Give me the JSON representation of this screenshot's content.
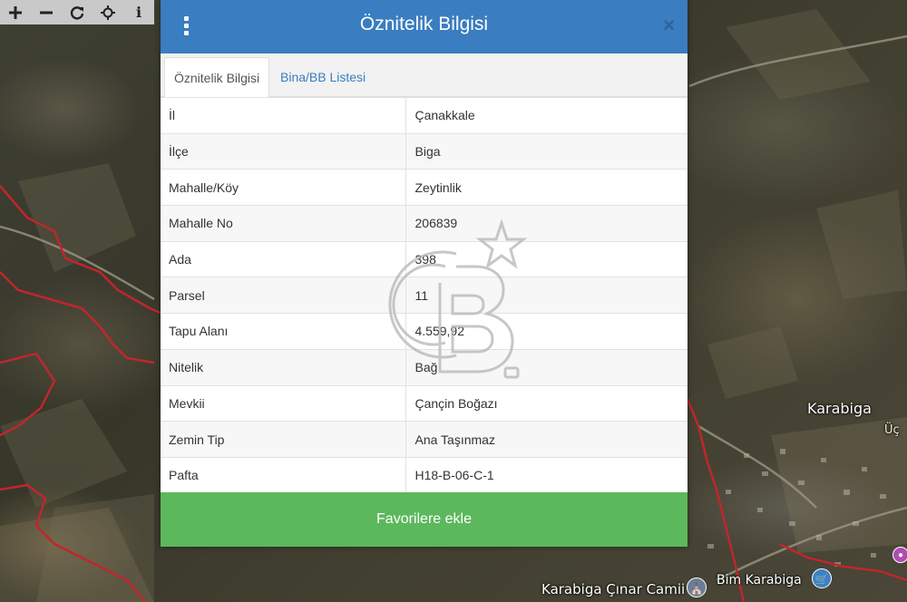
{
  "toolbar": {
    "zoom_in_icon": "plus-icon",
    "zoom_out_icon": "minus-icon",
    "refresh_icon": "refresh-icon",
    "locate_icon": "crosshair-icon",
    "info_label": "i"
  },
  "map": {
    "labels": {
      "town": "Karabiga",
      "town_partial": "Üç",
      "mosque": "Karabiga Çınar Camii",
      "market": "Bim Karabiga"
    },
    "parcel_boundary_color": "#c0262c"
  },
  "panel": {
    "title": "Öznitelik Bilgisi",
    "close_symbol": "×",
    "header_color": "#3a7dc0",
    "tabs": [
      {
        "label": "Öznitelik Bilgisi",
        "active": true
      },
      {
        "label": "Bina/BB Listesi",
        "active": false
      }
    ],
    "rows": [
      {
        "key": "İl",
        "value": "Çanakkale"
      },
      {
        "key": "İlçe",
        "value": "Biga"
      },
      {
        "key": "Mahalle/Köy",
        "value": "Zeytinlik"
      },
      {
        "key": "Mahalle No",
        "value": "206839"
      },
      {
        "key": "Ada",
        "value": "398"
      },
      {
        "key": "Parsel",
        "value": "11"
      },
      {
        "key": "Tapu Alanı",
        "value": "4.559,92"
      },
      {
        "key": "Nitelik",
        "value": "Bağ"
      },
      {
        "key": "Mevkii",
        "value": "Çançin Boğazı"
      },
      {
        "key": "Zemin Tip",
        "value": "Ana Taşınmaz"
      },
      {
        "key": "Pafta",
        "value": "H18-B-06-C-1"
      }
    ],
    "favorite_button": "Favorilere ekle",
    "favorite_color": "#5cb85c"
  },
  "watermark": {
    "letters": "CB",
    "mark": "SM"
  }
}
